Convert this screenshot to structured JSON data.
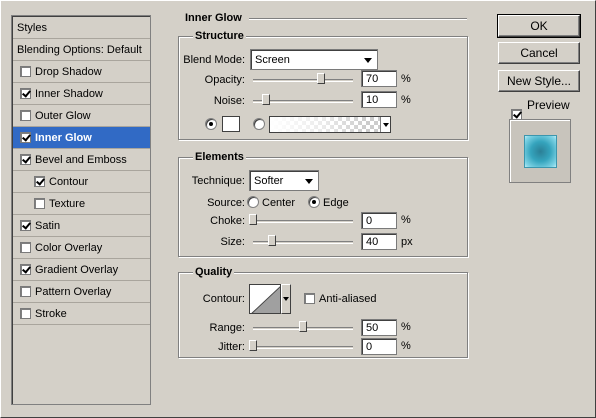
{
  "style_list": {
    "header": "Styles",
    "blending_options": "Blending Options: Default",
    "items": [
      {
        "label": "Drop Shadow",
        "checked": false
      },
      {
        "label": "Inner Shadow",
        "checked": true
      },
      {
        "label": "Outer Glow",
        "checked": false
      },
      {
        "label": "Inner Glow",
        "checked": true,
        "selected": true
      },
      {
        "label": "Bevel and Emboss",
        "checked": true
      },
      {
        "label": "Contour",
        "checked": true,
        "indent": true
      },
      {
        "label": "Texture",
        "checked": false,
        "indent": true
      },
      {
        "label": "Satin",
        "checked": true
      },
      {
        "label": "Color Overlay",
        "checked": false
      },
      {
        "label": "Gradient Overlay",
        "checked": true
      },
      {
        "label": "Pattern Overlay",
        "checked": false
      },
      {
        "label": "Stroke",
        "checked": false
      }
    ]
  },
  "panel": {
    "title": "Inner Glow",
    "structure": {
      "title": "Structure",
      "blend_mode_label": "Blend Mode:",
      "blend_mode_value": "Screen",
      "opacity_label": "Opacity:",
      "opacity_value": "70",
      "opacity_level": 0.7,
      "noise_label": "Noise:",
      "noise_value": "10",
      "noise_level": 0.1,
      "percent": "%",
      "color_mode": "solid",
      "swatch_color": "#ffffff"
    },
    "elements": {
      "title": "Elements",
      "technique_label": "Technique:",
      "technique_value": "Softer",
      "source_label": "Source:",
      "source_center": "Center",
      "source_edge": "Edge",
      "source_selected": "Edge",
      "choke_label": "Choke:",
      "choke_value": "0",
      "choke_level": 0.0,
      "size_label": "Size:",
      "size_value": "40",
      "size_level": 0.16,
      "percent": "%",
      "px": "px"
    },
    "quality": {
      "title": "Quality",
      "contour_label": "Contour:",
      "anti_aliased_label": "Anti-aliased",
      "anti_aliased": false,
      "range_label": "Range:",
      "range_value": "50",
      "range_level": 0.5,
      "jitter_label": "Jitter:",
      "jitter_value": "0",
      "jitter_level": 0.0,
      "percent": "%"
    }
  },
  "buttons": {
    "ok": "OK",
    "cancel": "Cancel",
    "new_style": "New Style...",
    "preview_label": "Preview",
    "preview_checked": true,
    "preview_color": "#35a4bd"
  }
}
